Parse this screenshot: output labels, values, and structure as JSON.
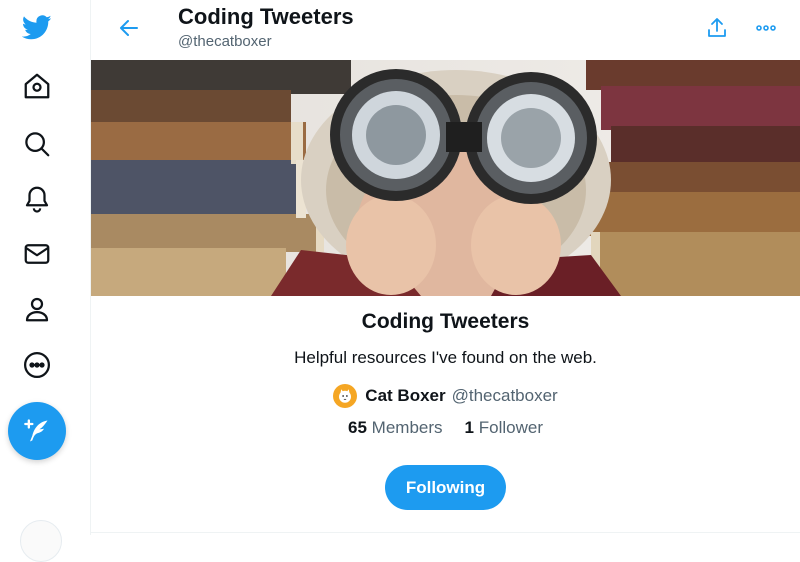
{
  "nav": {
    "items": [
      {
        "icon": "twitter-logo-icon"
      },
      {
        "icon": "home-icon"
      },
      {
        "icon": "search-icon"
      },
      {
        "icon": "bell-icon"
      },
      {
        "icon": "mail-icon"
      },
      {
        "icon": "profile-icon"
      },
      {
        "icon": "more-circle-icon"
      }
    ],
    "compose_icon": "compose-tweet-icon"
  },
  "header": {
    "title": "Coding Tweeters",
    "handle": "@thecatboxer",
    "back_icon": "back-arrow-icon",
    "share_icon": "share-icon",
    "more_icon": "more-dots-icon"
  },
  "banner": {
    "image": "person-with-binoculars-between-stacks-of-books"
  },
  "list": {
    "name": "Coding Tweeters",
    "description": "Helpful resources I've found on the web.",
    "owner_name": "Cat Boxer",
    "owner_handle": "@thecatboxer",
    "members_count": "65",
    "members_label": "Members",
    "followers_count": "1",
    "followers_label": "Follower",
    "following_button": "Following"
  },
  "colors": {
    "accent": "#1d9bf0",
    "text": "#0f1419",
    "secondary": "#536471"
  }
}
